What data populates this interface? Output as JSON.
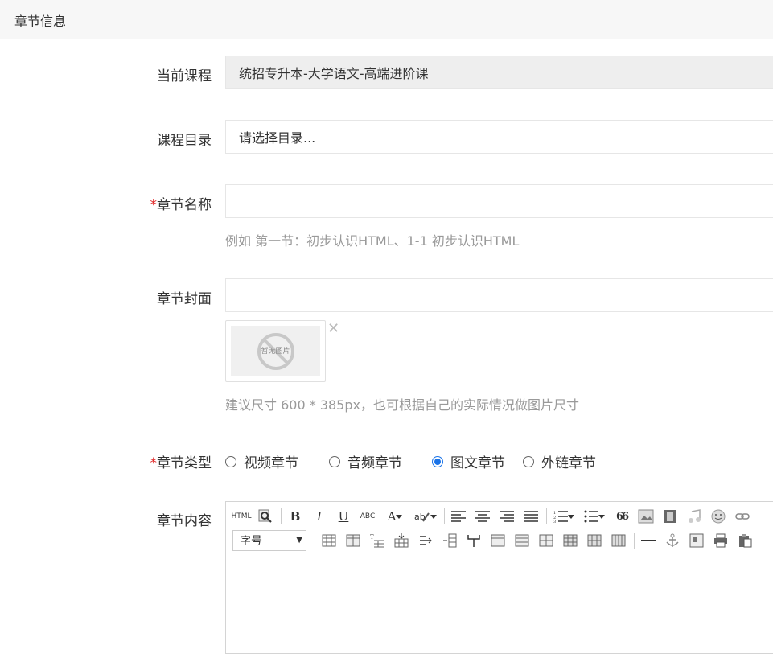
{
  "header": {
    "title": "章节信息"
  },
  "form": {
    "course": {
      "label": "当前课程",
      "value": "统招专升本-大学语文-高端进阶课"
    },
    "catalog": {
      "label": "课程目录",
      "placeholder": "请选择目录..."
    },
    "name": {
      "required_mark": "*",
      "label": "章节名称",
      "value": "",
      "hint": "例如 第一节：初步认识HTML、1-1 初步认识HTML"
    },
    "cover": {
      "label": "章节封面",
      "value": "",
      "thumb_text": "暂无图片",
      "remove_symbol": "✕",
      "hint": "建议尺寸 600 * 385px，也可根据自己的实际情况做图片尺寸"
    },
    "type": {
      "required_mark": "*",
      "label": "章节类型",
      "options": [
        {
          "label": "视频章节",
          "checked": false
        },
        {
          "label": "音频章节",
          "checked": false
        },
        {
          "label": "图文章节",
          "checked": true
        },
        {
          "label": "外链章节",
          "checked": false
        }
      ]
    },
    "content": {
      "label": "章节内容",
      "toolbar": {
        "html_label": "HTML",
        "bold": "B",
        "italic": "I",
        "underline": "U",
        "strike": "ABC",
        "font_color": "A",
        "quote": "66",
        "fontsize_label": "字号"
      }
    }
  }
}
